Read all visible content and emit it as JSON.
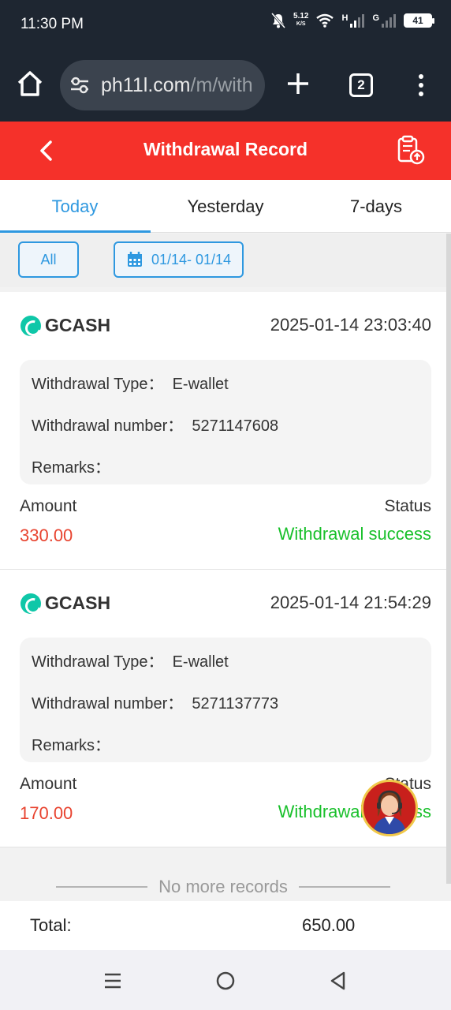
{
  "status_bar": {
    "time": "11:30 PM",
    "net_speed_value": "5.12",
    "net_speed_unit": "K/S",
    "signal1_label": "H",
    "signal2_label": "G",
    "battery": "41"
  },
  "browser": {
    "url_main": "ph11l.com",
    "url_path": "/m/with",
    "tab_count": "2"
  },
  "app": {
    "title": "Withdrawal Record"
  },
  "tabs": [
    {
      "label": "Today",
      "active": true
    },
    {
      "label": "Yesterday",
      "active": false
    },
    {
      "label": "7-days",
      "active": false
    }
  ],
  "filters": {
    "all_label": "All",
    "date_range": "01/14- 01/14"
  },
  "records": [
    {
      "method": "GCASH",
      "datetime": "2025-01-14 23:03:40",
      "type_line": "Withdrawal Type：  E-wallet",
      "number_line": "Withdrawal number：  5271147608",
      "remarks_line": "Remarks：",
      "amount_label": "Amount",
      "amount": "330.00",
      "status_label": "Status",
      "status": "Withdrawal success"
    },
    {
      "method": "GCASH",
      "datetime": "2025-01-14 21:54:29",
      "type_line": "Withdrawal Type：  E-wallet",
      "number_line": "Withdrawal number：  5271137773",
      "remarks_line": "Remarks：",
      "amount_label": "Amount",
      "amount": "170.00",
      "status_label": "Status",
      "status": "Withdrawal success"
    }
  ],
  "footer": {
    "no_more": "No more records",
    "total_label": "Total:",
    "total_value": "650.00"
  },
  "colors": {
    "header_red": "#f5312a",
    "accent_blue": "#2e98e0",
    "amount_red": "#e8432f",
    "success_green": "#19c02b"
  },
  "icons": [
    "home-icon",
    "tune-icon",
    "plus-icon",
    "tabs-icon",
    "more-vert-icon",
    "back-icon",
    "upload-record-icon",
    "calendar-icon",
    "gcash-logo-icon",
    "support-agent-icon",
    "recents-icon",
    "home-circle-icon",
    "back-triangle-icon"
  ]
}
